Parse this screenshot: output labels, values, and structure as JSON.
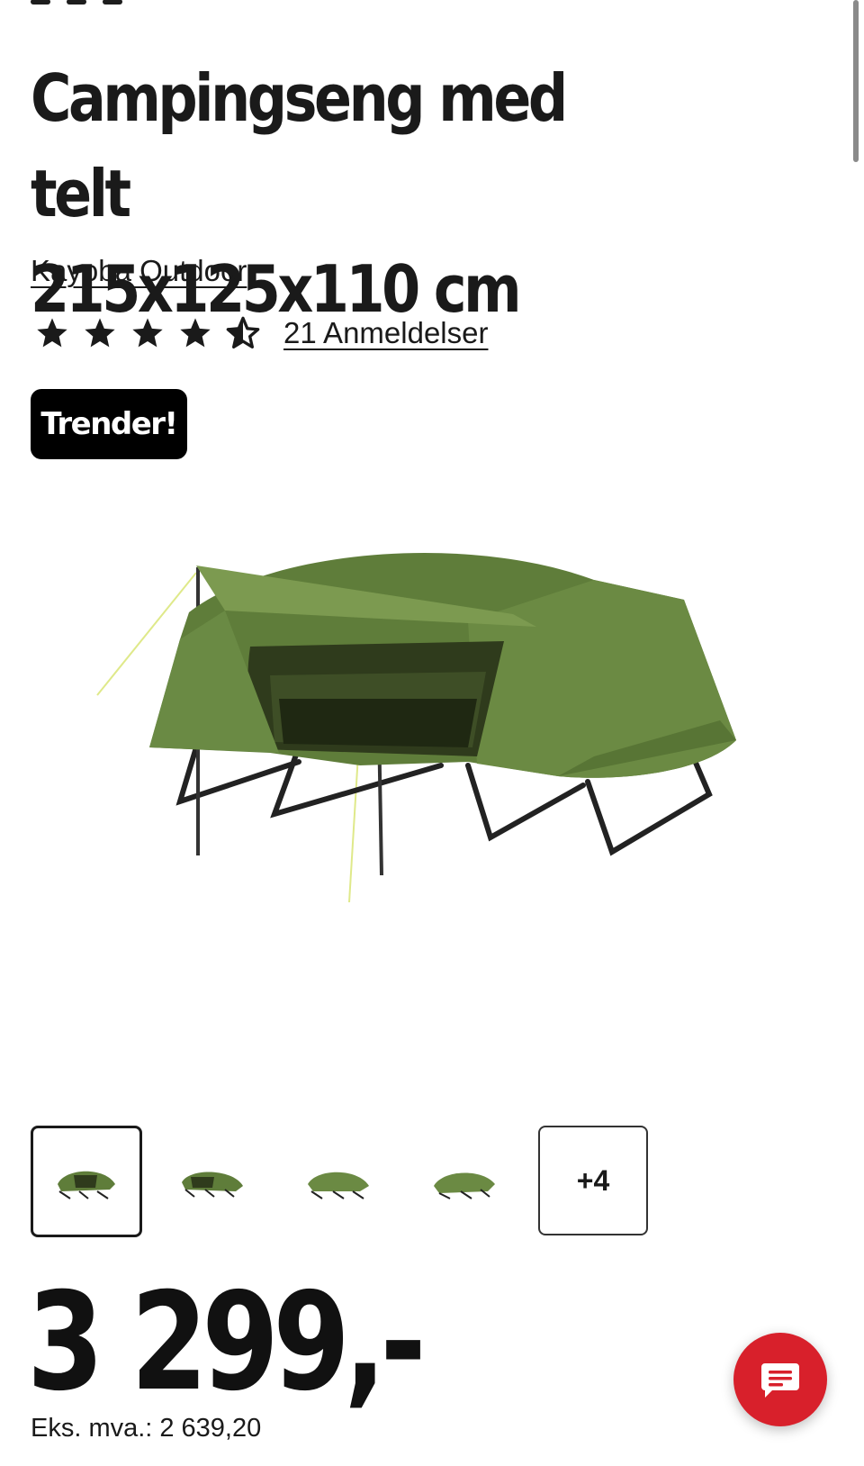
{
  "product": {
    "title_line1": "Campingseng med telt",
    "title_line2": "215x125x110 cm",
    "brand": "Kayoba Outdoor",
    "rating": 4.5,
    "rating_max": 5,
    "reviews_label": "21 Anmeldelser",
    "badge": "Trender!"
  },
  "gallery": {
    "thumbnails": [
      "tent-photo-1",
      "tent-photo-2",
      "tent-photo-3",
      "tent-photo-4"
    ],
    "more_label": "+4"
  },
  "price": {
    "amount": "3 299,-",
    "ex_vat_label": "Eks. mva.:",
    "ex_vat_value": "2 639,20"
  },
  "colors": {
    "accent": "#d8202b",
    "tent_green": "#5f7d3a",
    "text": "#1a1a1a"
  },
  "icons": {
    "star": "star-icon",
    "half_star": "half-star-icon",
    "chat": "chat-icon"
  }
}
